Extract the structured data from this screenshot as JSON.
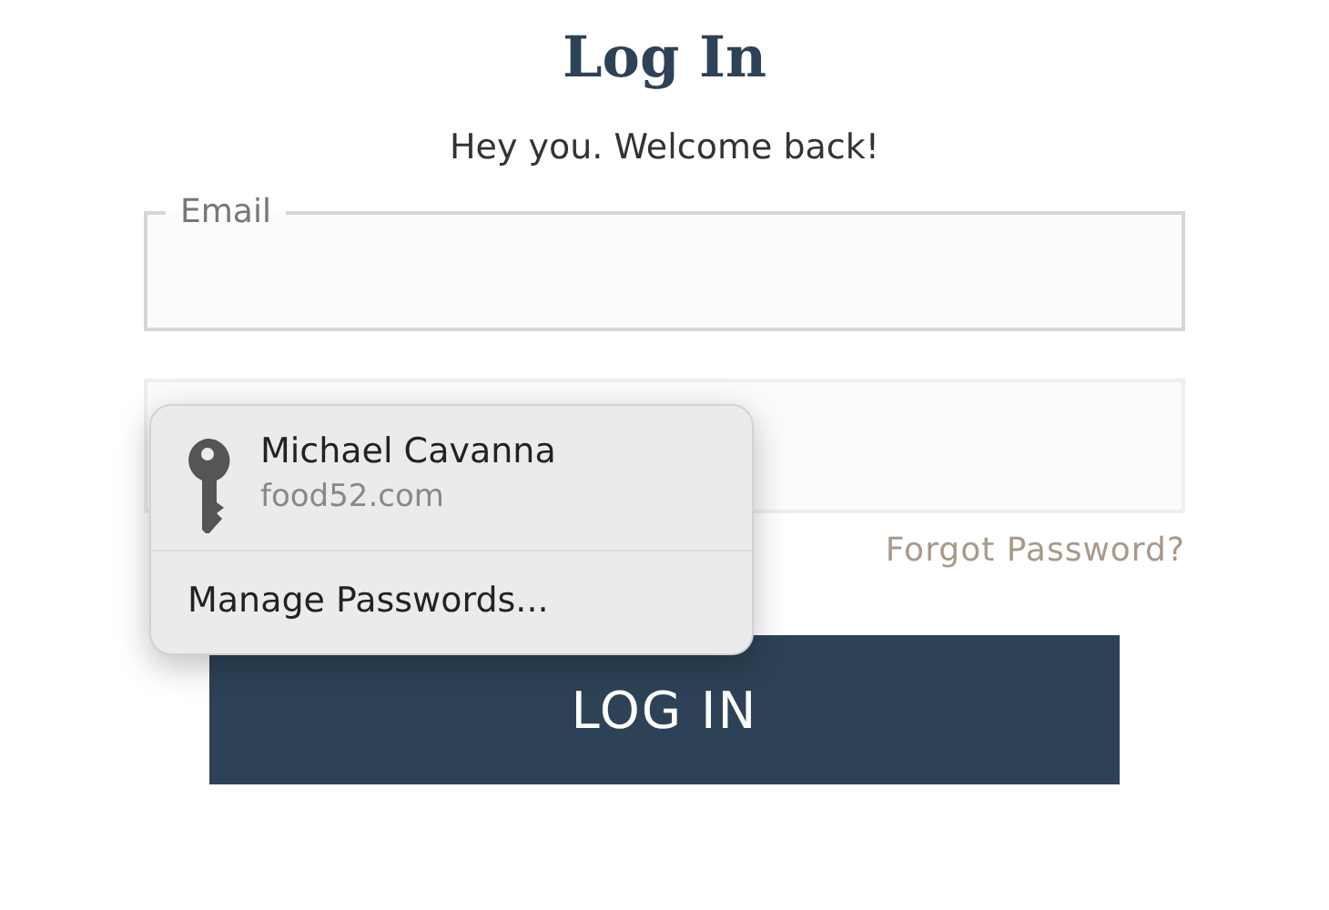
{
  "title": "Log In",
  "subtitle": "Hey you. Welcome back!",
  "email_field": {
    "label": "Email"
  },
  "autofill_menu": {
    "account": {
      "name": "Michael Cavanna",
      "site": "food52.com"
    },
    "manage": "Manage Passwords..."
  },
  "forgot_link": "Forgot Password?",
  "submit_button": "LOG IN"
}
